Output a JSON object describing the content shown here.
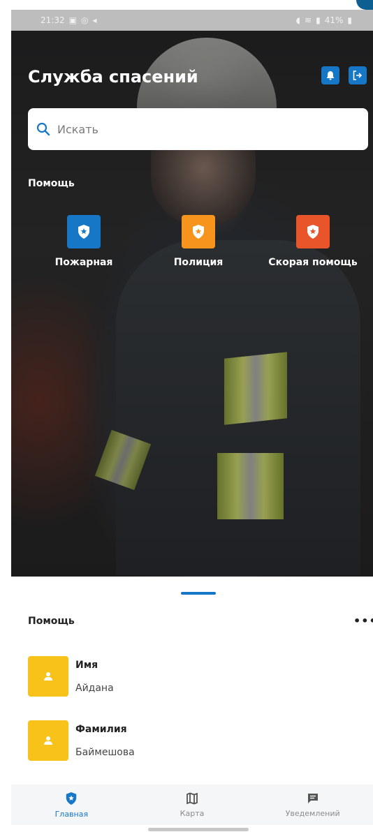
{
  "status_bar": {
    "time": "21:32",
    "battery": "41%"
  },
  "header": {
    "title": "Служба спасений"
  },
  "search": {
    "placeholder": "Искать"
  },
  "help": {
    "label": "Помощь",
    "services": [
      {
        "label": "Пожарная",
        "color": "#1677c6"
      },
      {
        "label": "Полиция",
        "color": "#f7941d"
      },
      {
        "label": "Скорая помощь",
        "color": "#e8552a"
      }
    ]
  },
  "sheet": {
    "title": "Помощь",
    "fields": [
      {
        "key": "Имя",
        "value": "Айдана"
      },
      {
        "key": "Фамилия",
        "value": "Баймешова"
      }
    ]
  },
  "nav": [
    {
      "label": "Главная",
      "icon": "shield-star-icon",
      "active": true
    },
    {
      "label": "Карта",
      "icon": "map-icon",
      "active": false
    },
    {
      "label": "Уведемлений",
      "icon": "message-icon",
      "active": false
    }
  ],
  "colors": {
    "accent": "#1677c6",
    "avatar": "#f7c21a"
  }
}
